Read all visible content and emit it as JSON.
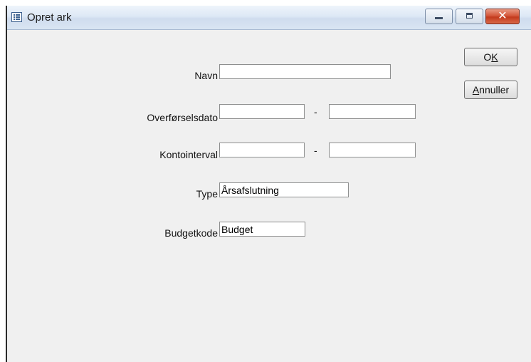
{
  "window": {
    "title": "Opret ark",
    "close_glyph": "✕",
    "icons": {
      "app": "form-window-icon",
      "min": "minimize-icon",
      "max": "maximize-icon",
      "close": "close-icon"
    }
  },
  "buttons": {
    "ok": {
      "pre": "O",
      "accel": "K",
      "post": ""
    },
    "cancel": {
      "pre": "",
      "accel": "A",
      "post": "nnuller"
    }
  },
  "form": {
    "navn": {
      "label": "Navn",
      "value": ""
    },
    "overforselsdato": {
      "label": "Overførselsdato",
      "from": "",
      "separator": "-",
      "to": ""
    },
    "kontointerval": {
      "label": "Kontointerval",
      "from": "",
      "separator": "-",
      "to": ""
    },
    "type": {
      "label": "Type",
      "value": "Årsafslutning"
    },
    "budgetkode": {
      "label": "Budgetkode",
      "value": "Budget"
    }
  }
}
